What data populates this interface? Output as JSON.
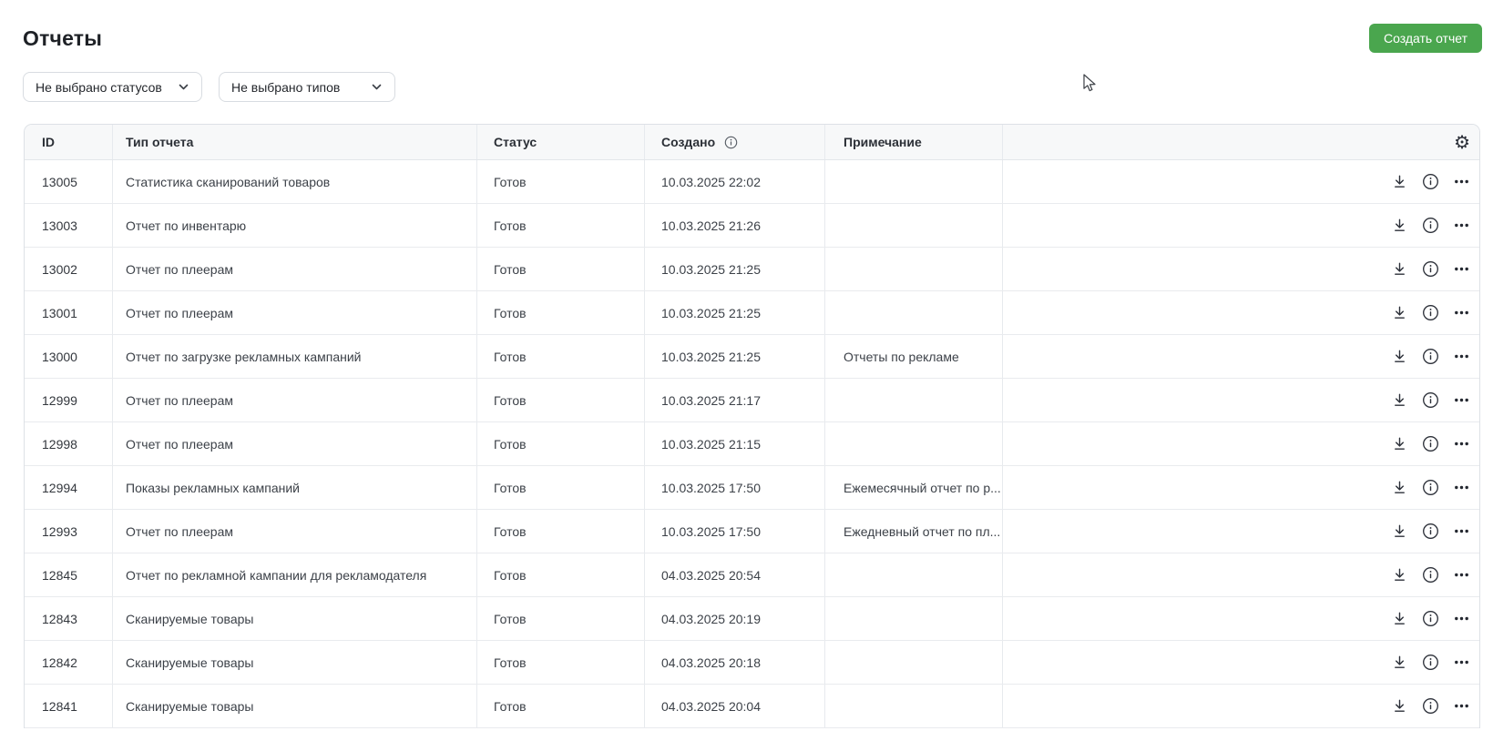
{
  "page": {
    "title": "Отчеты",
    "create_button": "Создать отчет"
  },
  "filters": {
    "status_placeholder": "Не выбрано статусов",
    "type_placeholder": "Не выбрано типов"
  },
  "table": {
    "columns": [
      "ID",
      "Тип отчета",
      "Статус",
      "Создано",
      "Примечание"
    ],
    "rows": [
      {
        "id": "13005",
        "type": "Статистика сканирований товаров",
        "status": "Готов",
        "created": "10.03.2025 22:02",
        "note": ""
      },
      {
        "id": "13003",
        "type": "Отчет по инвентарю",
        "status": "Готов",
        "created": "10.03.2025 21:26",
        "note": ""
      },
      {
        "id": "13002",
        "type": "Отчет по плеерам",
        "status": "Готов",
        "created": "10.03.2025 21:25",
        "note": ""
      },
      {
        "id": "13001",
        "type": "Отчет по плеерам",
        "status": "Готов",
        "created": "10.03.2025 21:25",
        "note": ""
      },
      {
        "id": "13000",
        "type": "Отчет по загрузке рекламных кампаний",
        "status": "Готов",
        "created": "10.03.2025 21:25",
        "note": "Отчеты по рекламе"
      },
      {
        "id": "12999",
        "type": "Отчет по плеерам",
        "status": "Готов",
        "created": "10.03.2025 21:17",
        "note": ""
      },
      {
        "id": "12998",
        "type": "Отчет по плеерам",
        "status": "Готов",
        "created": "10.03.2025 21:15",
        "note": ""
      },
      {
        "id": "12994",
        "type": "Показы рекламных кампаний",
        "status": "Готов",
        "created": "10.03.2025 17:50",
        "note": "Ежемесячный отчет по р..."
      },
      {
        "id": "12993",
        "type": "Отчет по плеерам",
        "status": "Готов",
        "created": "10.03.2025 17:50",
        "note": "Ежедневный отчет по пл..."
      },
      {
        "id": "12845",
        "type": "Отчет по рекламной кампании для рекламодателя",
        "status": "Готов",
        "created": "04.03.2025 20:54",
        "note": ""
      },
      {
        "id": "12843",
        "type": "Сканируемые товары",
        "status": "Готов",
        "created": "04.03.2025 20:19",
        "note": ""
      },
      {
        "id": "12842",
        "type": "Сканируемые товары",
        "status": "Готов",
        "created": "04.03.2025 20:18",
        "note": ""
      },
      {
        "id": "12841",
        "type": "Сканируемые товары",
        "status": "Готов",
        "created": "04.03.2025 20:04",
        "note": ""
      }
    ]
  },
  "icons": {
    "header_settings": "gear-icon",
    "created_hint": "info-icon",
    "filter_chevron": "chevron-down-icon",
    "row_download": "download-icon",
    "row_info": "info-icon",
    "row_more": "ellipsis-icon",
    "gear_glyph": "⚙",
    "cursor": "arrow-cursor"
  },
  "colors": {
    "accent_green": "#4aa64e",
    "header_bg": "#f7f8f9",
    "border": "#dde1e6",
    "text_primary": "#1e2126",
    "text_cell": "#3c4148"
  }
}
